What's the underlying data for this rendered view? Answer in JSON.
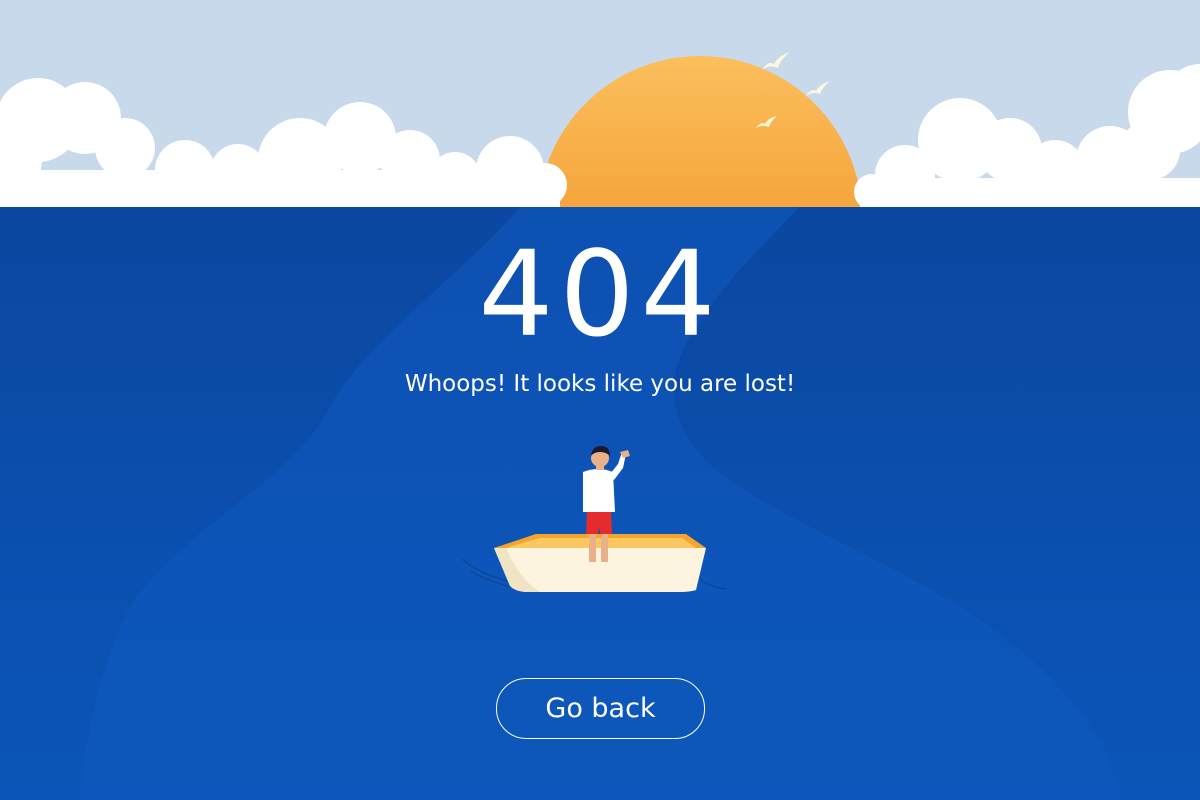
{
  "error": {
    "code": "404",
    "message": "Whoops! It looks like you are lost!"
  },
  "actions": {
    "back_label": "Go back"
  },
  "colors": {
    "sky": "#c9d9ec",
    "sea": "#0b47a1",
    "sun_top": "#fbbd5a",
    "sun_bottom": "#f08a1c",
    "cloud": "#ffffff",
    "text": "#ffffff",
    "boat_rim": "#f4a52e",
    "boat_hull": "#fdf6e3",
    "shorts": "#e52b2b"
  },
  "icons": {
    "back_button": "none"
  }
}
